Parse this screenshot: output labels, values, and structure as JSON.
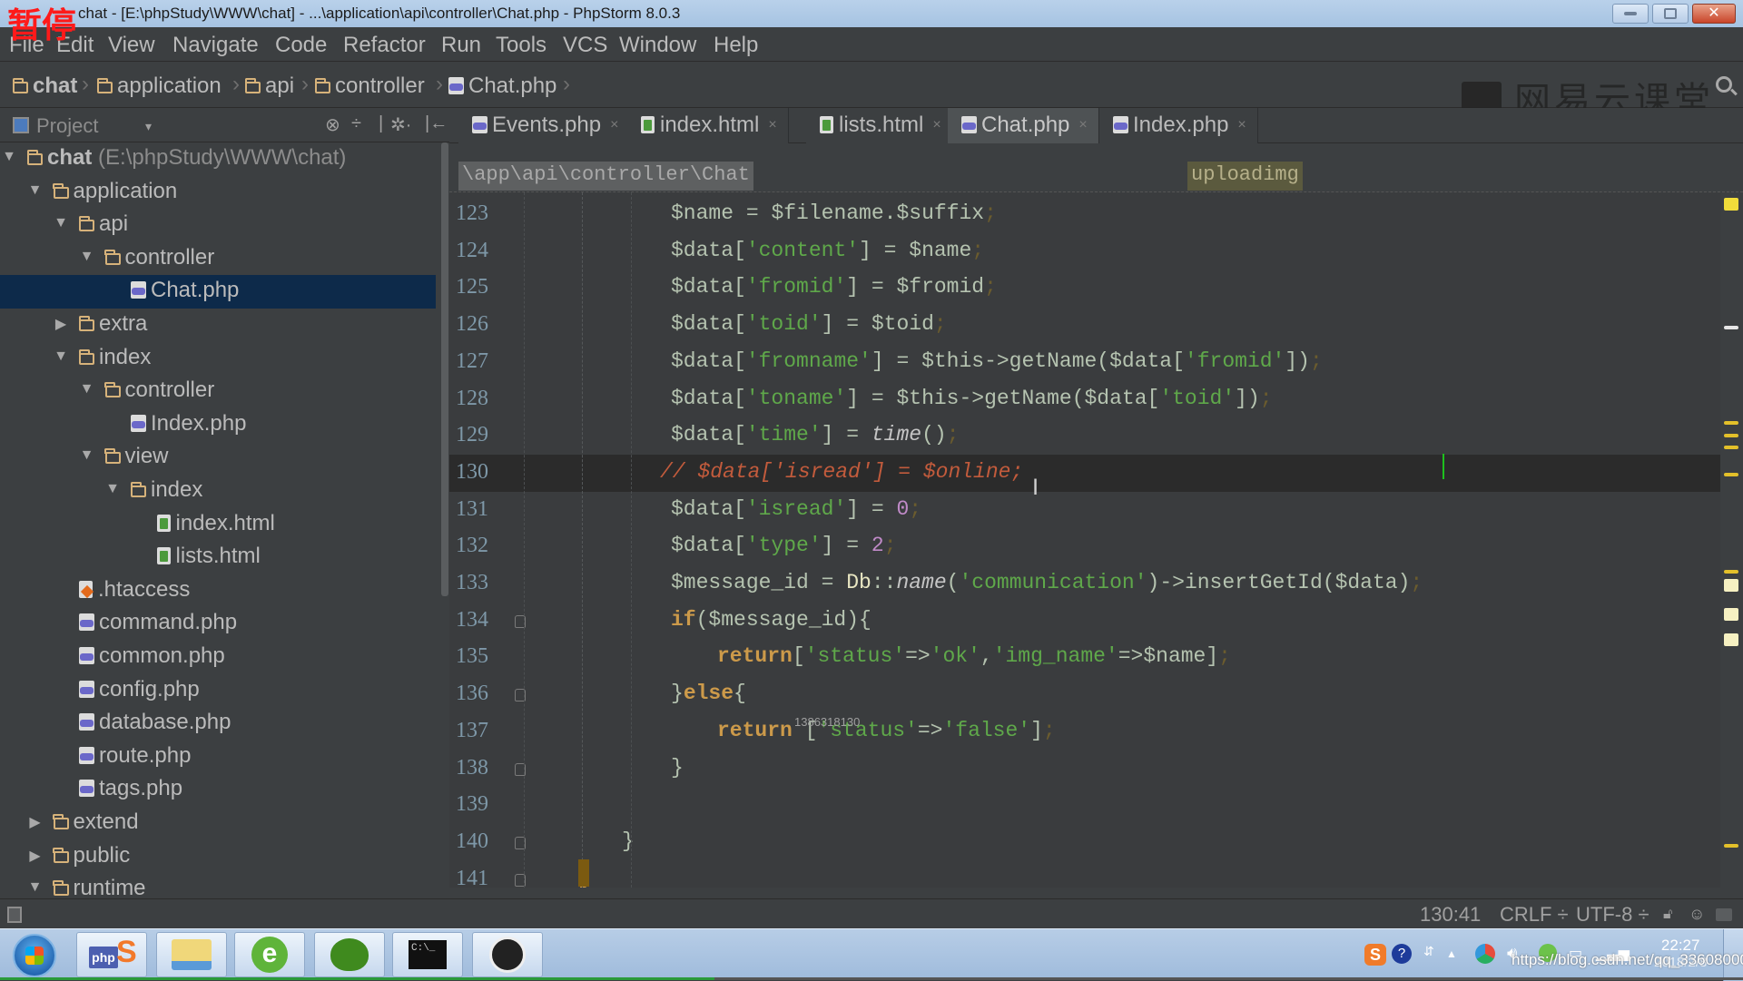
{
  "window": {
    "title": "chat - [E:\\phpStudy\\WWW\\chat] - ...\\application\\api\\controller\\Chat.php - PhpStorm 8.0.3",
    "pause_overlay": "暂停",
    "controls": {
      "minimize": "–",
      "maximize": "▢",
      "close": "✕"
    }
  },
  "menu": [
    "File",
    "Edit",
    "View",
    "Navigate",
    "Code",
    "Refactor",
    "Run",
    "Tools",
    "VCS",
    "Window",
    "Help"
  ],
  "nav_breadcrumb": [
    {
      "label": "chat",
      "icon": "folder-icon",
      "bold": true
    },
    {
      "label": "application",
      "icon": "folder-icon"
    },
    {
      "label": "api",
      "icon": "folder-icon"
    },
    {
      "label": "controller",
      "icon": "folder-icon"
    },
    {
      "label": "Chat.php",
      "icon": "php-file-icon"
    }
  ],
  "watermark_logo": "网易云课堂",
  "project_panel": {
    "title": "Project",
    "dropdown_glyph": "▾",
    "tools": [
      "⊗",
      "÷",
      "|",
      "✲·",
      "|←"
    ]
  },
  "tree": [
    {
      "label": "chat",
      "extra": " (E:\\phpStudy\\WWW\\chat)",
      "type": "folder",
      "depth": 0,
      "expanded": true,
      "bold": true
    },
    {
      "label": "application",
      "type": "folder",
      "depth": 1,
      "expanded": true
    },
    {
      "label": "api",
      "type": "folder",
      "depth": 2,
      "expanded": true
    },
    {
      "label": "controller",
      "type": "folder",
      "depth": 3,
      "expanded": true
    },
    {
      "label": "Chat.php",
      "type": "php",
      "depth": 4,
      "selected": true
    },
    {
      "label": "extra",
      "type": "folder",
      "depth": 2,
      "expanded": false
    },
    {
      "label": "index",
      "type": "folder",
      "depth": 2,
      "expanded": true
    },
    {
      "label": "controller",
      "type": "folder",
      "depth": 3,
      "expanded": true
    },
    {
      "label": "Index.php",
      "type": "php",
      "depth": 4
    },
    {
      "label": "view",
      "type": "folder",
      "depth": 3,
      "expanded": true
    },
    {
      "label": "index",
      "type": "folder",
      "depth": 4,
      "expanded": true
    },
    {
      "label": "index.html",
      "type": "html",
      "depth": 5
    },
    {
      "label": "lists.html",
      "type": "html",
      "depth": 5
    },
    {
      "label": ".htaccess",
      "type": "htaccess",
      "depth": 2
    },
    {
      "label": "command.php",
      "type": "php",
      "depth": 2
    },
    {
      "label": "common.php",
      "type": "php",
      "depth": 2
    },
    {
      "label": "config.php",
      "type": "php",
      "depth": 2
    },
    {
      "label": "database.php",
      "type": "php",
      "depth": 2
    },
    {
      "label": "route.php",
      "type": "php",
      "depth": 2
    },
    {
      "label": "tags.php",
      "type": "php",
      "depth": 2
    },
    {
      "label": "extend",
      "type": "folder",
      "depth": 1,
      "expanded": false
    },
    {
      "label": "public",
      "type": "folder",
      "depth": 1,
      "expanded": false
    },
    {
      "label": "runtime",
      "type": "folder",
      "depth": 1,
      "expanded": true
    }
  ],
  "tabs": [
    {
      "label": "Events.php",
      "type": "php"
    },
    {
      "label": "index.html",
      "type": "html"
    },
    {
      "label": "lists.html",
      "type": "html"
    },
    {
      "label": "Chat.php",
      "type": "php",
      "active": true
    },
    {
      "label": "Index.php",
      "type": "php"
    }
  ],
  "tab_close_glyph": "×",
  "editor_breadcrumb": {
    "namespace": "\\app\\api\\controller\\Chat",
    "method": "uploadimg"
  },
  "code": [
    {
      "n": "123",
      "indent": 3,
      "tokens": [
        [
          "var",
          "$name"
        ],
        [
          "plain",
          " = "
        ],
        [
          "var",
          "$filename"
        ],
        [
          "plain",
          "."
        ],
        [
          "var",
          "$suffix"
        ],
        [
          "semi",
          ";"
        ]
      ]
    },
    {
      "n": "124",
      "indent": 3,
      "tokens": [
        [
          "var",
          "$data["
        ],
        [
          "str",
          "'content'"
        ],
        [
          "var",
          "] = $name"
        ],
        [
          "semi",
          ";"
        ]
      ]
    },
    {
      "n": "125",
      "indent": 3,
      "tokens": [
        [
          "var",
          "$data["
        ],
        [
          "str",
          "'fromid'"
        ],
        [
          "var",
          "] = $fromid"
        ],
        [
          "semi",
          ";"
        ]
      ]
    },
    {
      "n": "126",
      "indent": 3,
      "tokens": [
        [
          "var",
          "$data["
        ],
        [
          "str",
          "'toid'"
        ],
        [
          "var",
          "] = $toid"
        ],
        [
          "semi",
          ";"
        ]
      ]
    },
    {
      "n": "127",
      "indent": 3,
      "tokens": [
        [
          "var",
          "$data["
        ],
        [
          "str",
          "'fromname'"
        ],
        [
          "var",
          "] = $this->getName($data["
        ],
        [
          "str",
          "'fromid'"
        ],
        [
          "var",
          "])"
        ],
        [
          "semi",
          ";"
        ]
      ]
    },
    {
      "n": "128",
      "indent": 3,
      "tokens": [
        [
          "var",
          "$data["
        ],
        [
          "str",
          "'toname'"
        ],
        [
          "var",
          "] = $this->getName($data["
        ],
        [
          "str",
          "'toid'"
        ],
        [
          "var",
          "])"
        ],
        [
          "semi",
          ";"
        ]
      ]
    },
    {
      "n": "129",
      "indent": 3,
      "tokens": [
        [
          "var",
          "$data["
        ],
        [
          "str",
          "'time'"
        ],
        [
          "var",
          "] = "
        ],
        [
          "fnit",
          "time"
        ],
        [
          "var",
          "()"
        ],
        [
          "semi",
          ";"
        ]
      ]
    },
    {
      "n": "130",
      "indent": 3,
      "current": true,
      "tokens": [
        [
          "comment",
          "// $data['isread'] = $online;"
        ]
      ]
    },
    {
      "n": "131",
      "indent": 3,
      "tokens": [
        [
          "var",
          "$data["
        ],
        [
          "str",
          "'isread'"
        ],
        [
          "var",
          "] = "
        ],
        [
          "num",
          "0"
        ],
        [
          "semi",
          ";"
        ]
      ]
    },
    {
      "n": "132",
      "indent": 3,
      "tokens": [
        [
          "var",
          "$data["
        ],
        [
          "str",
          "'type'"
        ],
        [
          "var",
          "] = "
        ],
        [
          "num",
          "2"
        ],
        [
          "semi",
          ";"
        ]
      ]
    },
    {
      "n": "133",
      "indent": 3,
      "tokens": [
        [
          "var",
          "$message_id = "
        ],
        [
          "db",
          "Db"
        ],
        [
          "var",
          "::"
        ],
        [
          "fnit",
          "name"
        ],
        [
          "var",
          "("
        ],
        [
          "str",
          "'communication'"
        ],
        [
          "var",
          ")->insertGetId($data)"
        ],
        [
          "semi",
          ";"
        ]
      ]
    },
    {
      "n": "134",
      "indent": 3,
      "fold": true,
      "tokens": [
        [
          "kw",
          "if"
        ],
        [
          "var",
          "($message_id){"
        ]
      ]
    },
    {
      "n": "135",
      "indent": 4,
      "tokens": [
        [
          "kw",
          "return"
        ],
        [
          "var",
          "["
        ],
        [
          "str",
          "'status'"
        ],
        [
          "var",
          "=>"
        ],
        [
          "str",
          "'ok'"
        ],
        [
          "var",
          ","
        ],
        [
          "str",
          "'img_name'"
        ],
        [
          "var",
          "=>$name]"
        ],
        [
          "semi",
          ";"
        ]
      ]
    },
    {
      "n": "136",
      "indent": 3,
      "fold": true,
      "tokens": [
        [
          "var",
          "}"
        ],
        [
          "kw",
          "else"
        ],
        [
          "var",
          "{"
        ]
      ]
    },
    {
      "n": "137",
      "indent": 4,
      "tokens": [
        [
          "kw",
          "return"
        ],
        [
          "var",
          " ["
        ],
        [
          "str",
          "'status'"
        ],
        [
          "var",
          "=>"
        ],
        [
          "str",
          "'false'"
        ],
        [
          "var",
          "]"
        ],
        [
          "semi",
          ";"
        ]
      ]
    },
    {
      "n": "138",
      "indent": 3,
      "fold": true,
      "tokens": [
        [
          "var",
          "}"
        ]
      ]
    },
    {
      "n": "139",
      "indent": 0,
      "tokens": []
    },
    {
      "n": "140",
      "indent": 2,
      "fold": true,
      "tokens": [
        [
          "var",
          "}"
        ]
      ]
    },
    {
      "n": "141",
      "indent": 1,
      "fold": true,
      "tokens": [
        [
          "kw",
          "}"
        ]
      ]
    }
  ],
  "overlay_number": "1386318130",
  "status": {
    "position": "130:41",
    "line_sep": "CRLF ÷",
    "encoding": "UTF-8 ÷"
  },
  "taskbar": {
    "apps": [
      "phpstudy",
      "file-explorer",
      "browser",
      "navicat",
      "cmd",
      "obs"
    ],
    "clock_time": "22:27",
    "clock_date": "2018/2/8",
    "watermark": "https://blog.csdn.net/qq_33608000"
  },
  "colors": {
    "editor_bg": "#3a3c3e",
    "panel_bg": "#3c3f41",
    "selection": "#0d2a4a",
    "string": "#5fa84a",
    "keyword": "#cc9a4a",
    "comment": "#c25b3c",
    "number": "#c08ac8"
  }
}
